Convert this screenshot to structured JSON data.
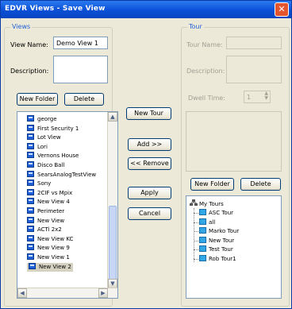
{
  "window": {
    "title": "EDVR Views - Save View",
    "close_label": "✕"
  },
  "views": {
    "group_label": "Views",
    "view_name_label": "View Name:",
    "view_name_value": "Demo View 1",
    "description_label": "Description:",
    "new_folder_label": "New Folder",
    "delete_label": "Delete",
    "items": [
      {
        "label": "george"
      },
      {
        "label": "First Security 1"
      },
      {
        "label": "Lot View"
      },
      {
        "label": "Lori"
      },
      {
        "label": "Vernons House"
      },
      {
        "label": "Disco Ball"
      },
      {
        "label": "SearsAnalogTestView"
      },
      {
        "label": "Sony"
      },
      {
        "label": "2CIF vs Mpix"
      },
      {
        "label": "New View 4"
      },
      {
        "label": "Perimeter"
      },
      {
        "label": "New View"
      },
      {
        "label": "ACTi 2x2"
      },
      {
        "label": "New View KC"
      },
      {
        "label": "New View 9"
      },
      {
        "label": "New View 1"
      },
      {
        "label": "New View 2"
      }
    ],
    "selected_item": "New View 2"
  },
  "middle": {
    "new_tour_label": "New Tour",
    "add_label": "Add >>",
    "remove_label": "<< Remove",
    "apply_label": "Apply",
    "cancel_label": "Cancel"
  },
  "tour": {
    "group_label": "Tour",
    "tour_name_label": "Tour Name:",
    "description_label": "Description:",
    "dwell_time_label": "Dwell Time:",
    "dwell_time_value": "1",
    "new_folder_label": "New Folder",
    "delete_label": "Delete",
    "root_label": "My Tours",
    "items": [
      {
        "label": "ASC Tour"
      },
      {
        "label": "all"
      },
      {
        "label": "Marko Tour"
      },
      {
        "label": "New Tour"
      },
      {
        "label": "Test Tour"
      },
      {
        "label": "Rob Tour1"
      }
    ]
  },
  "colors": {
    "title_bar": "#0a4fd6",
    "group_label": "#1f5fd8",
    "close_button": "#e2552f",
    "selection": "#d6d2c2"
  },
  "icons": {
    "view": "monitor-icon",
    "tour": "tour-icon",
    "root": "tours-root-icon",
    "close": "close-icon"
  }
}
